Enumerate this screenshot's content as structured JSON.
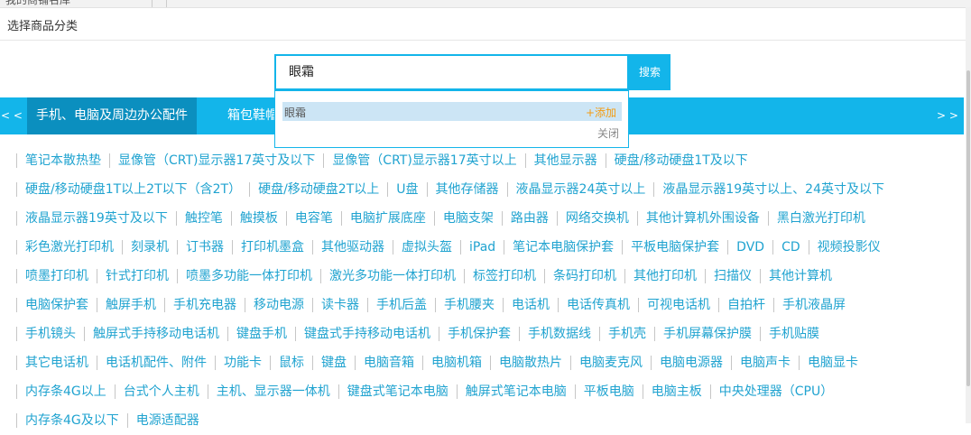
{
  "background_tab": {
    "label": "我的商铺名库"
  },
  "dialog": {
    "title": "选择商品分类"
  },
  "search": {
    "value": "眼霜",
    "button_label": "搜索"
  },
  "suggestion": {
    "text": "眼霜",
    "add_label": "+添加",
    "close_label": "关闭"
  },
  "category_bar": {
    "prev_label": "< <",
    "next_label": "> >",
    "active_tab": "手机、电脑及周边办公配件",
    "next_tab": "箱包鞋帽"
  },
  "items": [
    [
      "笔记本散热垫",
      "显像管（CRT)显示器17英寸及以下",
      "显像管（CRT)显示器17英寸以上",
      "其他显示器",
      "硬盘/移动硬盘1T及以下"
    ],
    [
      "硬盘/移动硬盘1T以上2T以下（含2T）",
      "硬盘/移动硬盘2T以上",
      "U盘",
      "其他存储器",
      "液晶显示器24英寸以上",
      "液晶显示器19英寸以上、24英寸及以下"
    ],
    [
      "液晶显示器19英寸及以下",
      "触控笔",
      "触摸板",
      "电容笔",
      "电脑扩展底座",
      "电脑支架",
      "路由器",
      "网络交换机",
      "其他计算机外围设备",
      "黑白激光打印机"
    ],
    [
      "彩色激光打印机",
      "刻录机",
      "订书器",
      "打印机墨盒",
      "其他驱动器",
      "虚拟头盔",
      "iPad",
      "笔记本电脑保护套",
      "平板电脑保护套",
      "DVD",
      "CD",
      "视频投影仪"
    ],
    [
      "喷墨打印机",
      "针式打印机",
      "喷墨多功能一体打印机",
      "激光多功能一体打印机",
      "标签打印机",
      "条码打印机",
      "其他打印机",
      "扫描仪",
      "其他计算机"
    ],
    [
      "电脑保护套",
      "触屏手机",
      "手机充电器",
      "移动电源",
      "读卡器",
      "手机后盖",
      "手机腰夹",
      "电话机",
      "电话传真机",
      "可视电话机",
      "自拍杆",
      "手机液晶屏"
    ],
    [
      "手机镜头",
      "触屏式手持移动电话机",
      "键盘手机",
      "键盘式手持移动电话机",
      "手机保护套",
      "手机数据线",
      "手机壳",
      "手机屏幕保护膜",
      "手机贴膜"
    ],
    [
      "其它电话机",
      "电话机配件、附件",
      "功能卡",
      "鼠标",
      "键盘",
      "电脑音箱",
      "电脑机箱",
      "电脑散热片",
      "电脑麦克风",
      "电脑电源器",
      "电脑声卡",
      "电脑显卡"
    ],
    [
      "内存条4G以上",
      "台式个人主机",
      "主机、显示器一体机",
      "键盘式笔记本电脑",
      "触屏式笔记本电脑",
      "平板电脑",
      "电脑主板",
      "中央处理器（CPU）"
    ],
    [
      "内存条4G及以下",
      "电源适配器"
    ]
  ]
}
